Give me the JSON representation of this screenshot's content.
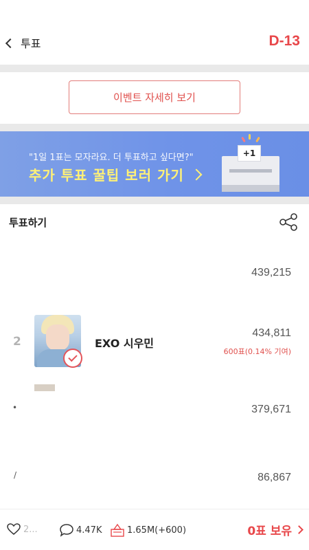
{
  "header": {
    "back_label": "투표",
    "dday": "D-13"
  },
  "event_button": {
    "label": "이벤트 자세히 보기"
  },
  "banner": {
    "subtitle": "\"1일 1표는 모자라요. 더 투표하고 싶다면?\"",
    "title": "추가 투표 꿀팁 보러 가기",
    "ballot_badge": "+1"
  },
  "section": {
    "title": "투표하기"
  },
  "ranking": [
    {
      "votes": "439,215"
    },
    {
      "rank": "2",
      "name": "EXO 시우민",
      "votes": "434,811",
      "contribution": "600표(0.14% 기여)"
    },
    {
      "votes": "379,671"
    },
    {
      "votes": "86,867"
    }
  ],
  "bottom": {
    "likes": "2...",
    "comments": "4.47K",
    "ballots": "1.65M(+600)",
    "hold": "0표 보유"
  },
  "colors": {
    "accent": "#e8474a",
    "banner": "#6f93e8",
    "banner_highlight": "#fff176"
  }
}
